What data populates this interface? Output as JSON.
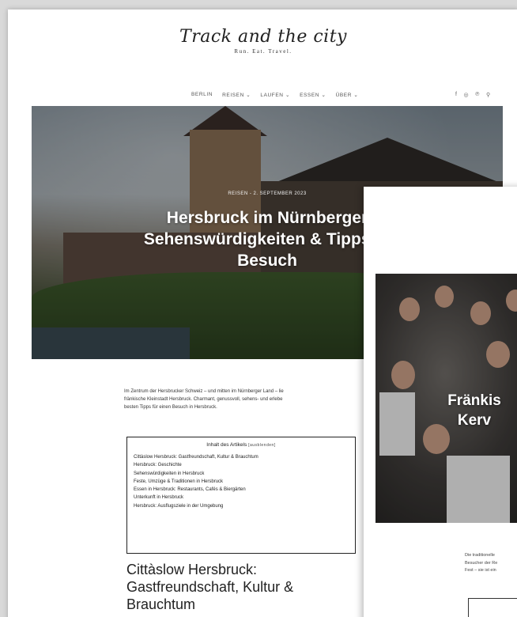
{
  "site": {
    "logo_script": "Track and the city",
    "logo_tagline": "Run. Eat. Travel."
  },
  "nav": {
    "items": [
      "BERLIN",
      "REISEN ⌄",
      "LAUFEN ⌄",
      "ESSEN ⌄",
      "ÜBER ⌄"
    ],
    "social_icons": [
      "facebook-icon",
      "instagram-icon",
      "pinterest-icon",
      "search-icon"
    ]
  },
  "article": {
    "meta": "REISEN - 2. SEPTEMBER 2023",
    "title": "Hersbruck im Nürnberger Land: Sehenswürdigkeiten & Tipps für deinen Besuch",
    "title_line1": "Hersbruck im Nürnberger",
    "title_line2": "Sehenswürdigkeiten & Tipps fü",
    "title_line3": "Besuch",
    "intro_line1": "Im Zentrum der Hersbrucker Schweiz – und mitten im Nürnberger Land – lie",
    "intro_line2": "fränkische Kleinstadt Hersbruck. Charmant, genussvoll, sehens- und erlebe",
    "intro_line3": "besten Tipps für einen Besuch in Hersbruck.",
    "toc": {
      "heading": "Inhalt des Artikels",
      "toggle": "[ausblenden]",
      "items": [
        "Cittàslow Hersbruck: Gastfreundschaft, Kultur & Brauchtum",
        "Hersbruck: Geschichte",
        "Sehenswürdigkeiten in Hersbruck",
        "Feste, Umzüge & Traditionen in Hersbruck",
        "Essen in Hersbruck: Restaurants, Cafés & Biergärten",
        "Unterkunft in Hersbruck",
        "Hersbruck: Ausflugsziele in der Umgebung"
      ]
    },
    "section_heading_line1": "Cittàslow Hersbruck:",
    "section_heading_line2": "Gastfreundschaft, Kultur &",
    "section_heading_line3": "Brauchtum"
  },
  "front_article": {
    "title_line1": "Fränkis",
    "title_line2": "Kerv",
    "text_line1": "Die traditionelle",
    "text_line2": "Besucher der Re",
    "text_line3": "Fest – sie ist ein"
  },
  "colors": {
    "text": "#222222",
    "background": "#ffffff",
    "desktop": "#d9d9d9"
  }
}
